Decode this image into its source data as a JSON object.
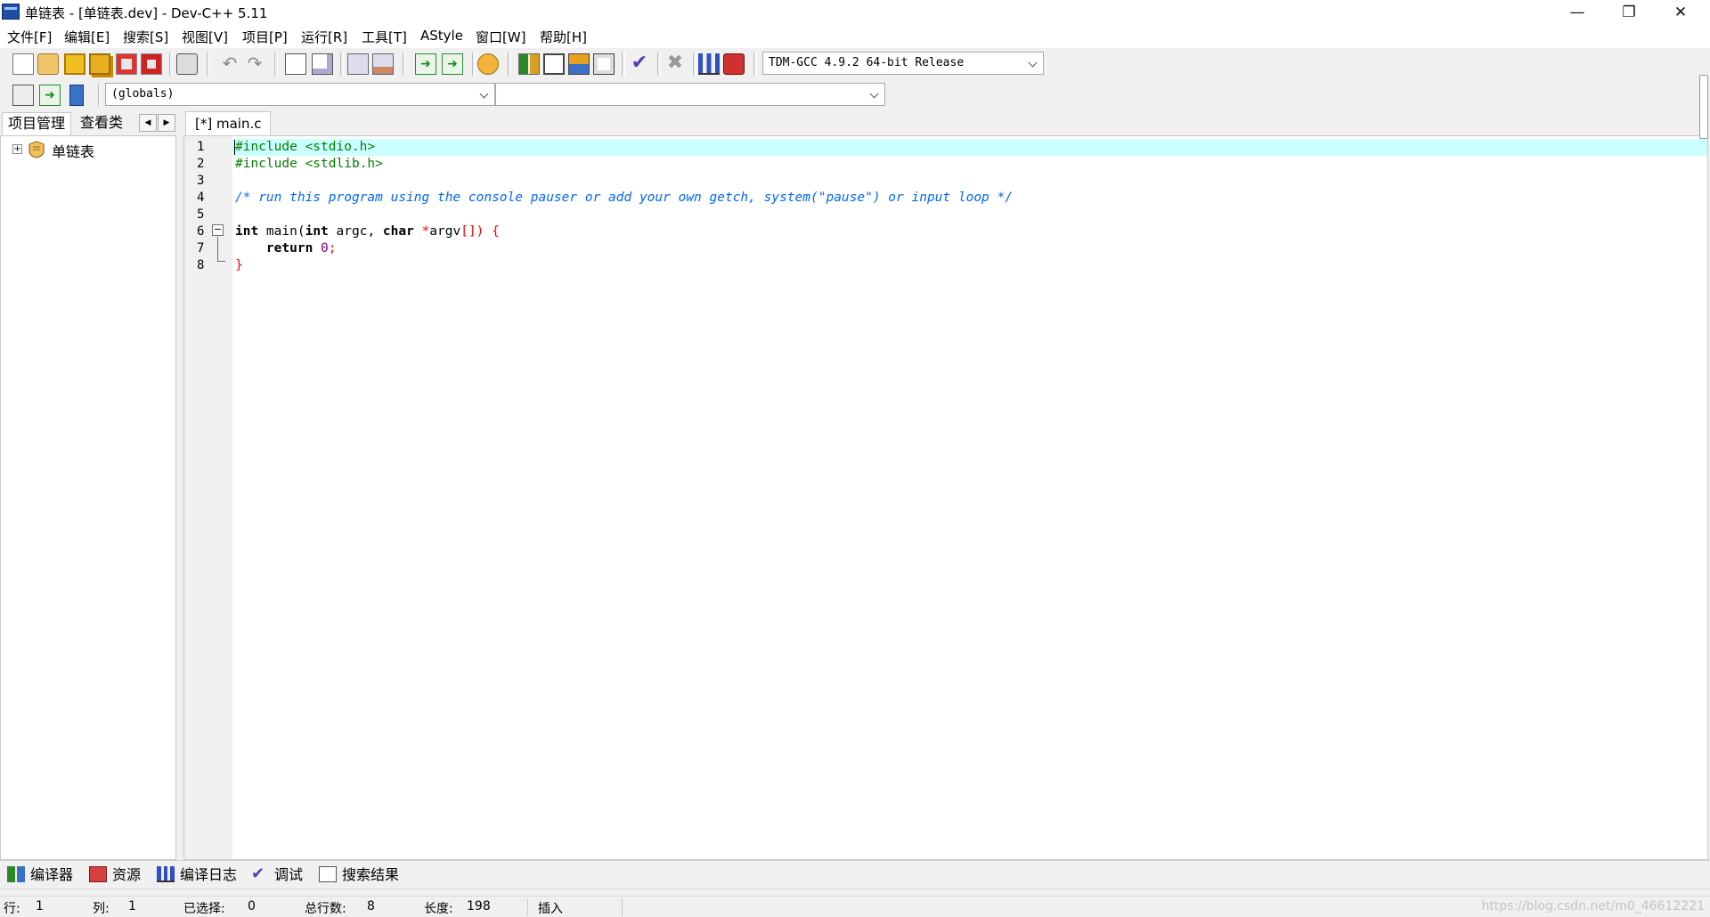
{
  "window": {
    "title": "单链表 - [单链表.dev] - Dev-C++ 5.11",
    "minimize": "—",
    "restore": "❐",
    "close": "✕"
  },
  "menu": [
    "文件[F]",
    "编辑[E]",
    "搜索[S]",
    "视图[V]",
    "项目[P]",
    "运行[R]",
    "工具[T]",
    "AStyle",
    "窗口[W]",
    "帮助[H]"
  ],
  "toolbar": {
    "compiler_select": "TDM-GCC 4.9.2 64-bit Release",
    "scope_select": "(globals)",
    "member_select": ""
  },
  "left_panel": {
    "tabs": [
      "项目管理",
      "查看类"
    ],
    "tree_root": "单链表"
  },
  "editor": {
    "tab_label": "[*] main.c",
    "line_numbers": [
      "1",
      "2",
      "3",
      "4",
      "5",
      "6",
      "7",
      "8"
    ],
    "lines": {
      "l1": "#include <stdio.h>",
      "l2": "#include <stdlib.h>",
      "l4": "/* run this program using the console pauser or add your own getch, system(\"pause\") or input loop */",
      "l6_kw1": "int",
      "l6_fn": " main(",
      "l6_kw2": "int",
      "l6_a": " argc, ",
      "l6_kw3": "char",
      "l6_b": " ",
      "l6_star": "*",
      "l6_c": "argv",
      "l6_brk": "[]) {",
      "l7_indent": "    ",
      "l7_kw": "return",
      "l7_sp": " ",
      "l7_num": "0",
      "l7_semi": ";",
      "l8": "}"
    }
  },
  "bottom_tabs": [
    "编译器",
    "资源",
    "编译日志",
    "调试",
    "搜索结果"
  ],
  "status": {
    "row_label": "行:",
    "row_value": "1",
    "col_label": "列:",
    "col_value": "1",
    "sel_label": "已选择:",
    "sel_value": "0",
    "total_label": "总行数:",
    "total_value": "8",
    "len_label": "长度:",
    "len_value": "198",
    "mode": "插入",
    "watermark": "https://blog.csdn.net/m0_46612221"
  },
  "colors": {
    "current_line": "#ccffff",
    "preprocessor": "#008000",
    "comment": "#0066ff",
    "symbol": "#ff0000",
    "number": "#800080"
  }
}
